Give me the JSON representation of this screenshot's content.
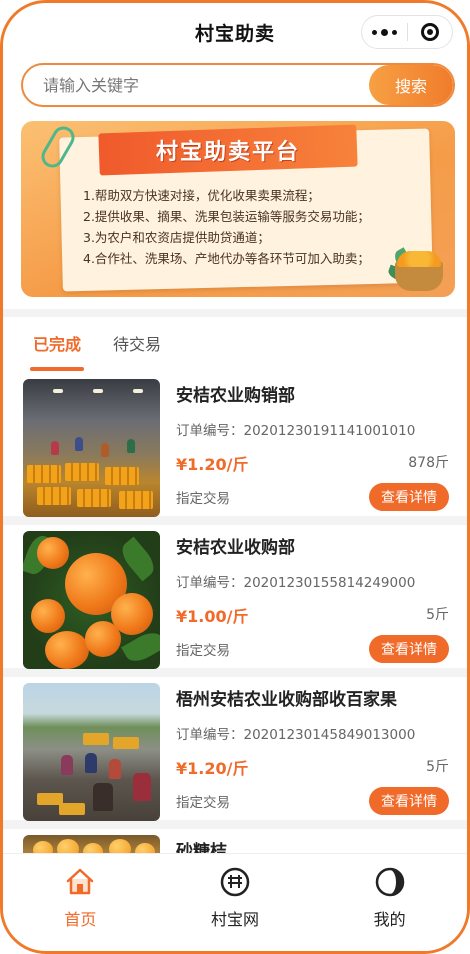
{
  "header": {
    "title": "村宝助卖",
    "more_icon": "more-dots-icon",
    "close_icon": "target-close-icon"
  },
  "search": {
    "placeholder": "请输入关键字",
    "button_label": "搜索"
  },
  "banner": {
    "heading": "村宝助卖平台",
    "lines": [
      "1.帮助双方快速对接，优化收果卖果流程；",
      "2.提供收果、摘果、洗果包装运输等服务交易功能；",
      "3.为农户和农资店提供助贷通道；",
      "4.合作社、洗果场、产地代办等各环节可加入助卖；"
    ]
  },
  "tabs": [
    {
      "label": "已完成",
      "active": true
    },
    {
      "label": "待交易",
      "active": false
    }
  ],
  "orders": [
    {
      "name": "安桔农业购销部",
      "order_label": "订单编号：",
      "order_no": "20201230191141001010",
      "price": "¥1.20/斤",
      "qty": "878斤",
      "trade": "指定交易",
      "button": "查看详情"
    },
    {
      "name": "安桔农业收购部",
      "order_label": "订单编号：",
      "order_no": "20201230155814249000",
      "price": "¥1.00/斤",
      "qty": "5斤",
      "trade": "指定交易",
      "button": "查看详情"
    },
    {
      "name": "梧州安桔农业收购部收百家果",
      "order_label": "订单编号：",
      "order_no": "20201230145849013000",
      "price": "¥1.20/斤",
      "qty": "5斤",
      "trade": "指定交易",
      "button": "查看详情"
    },
    {
      "name": "砂糖桔",
      "order_label": "",
      "order_no": "",
      "price": "",
      "qty": "",
      "trade": "",
      "button": ""
    }
  ],
  "bottom_nav": [
    {
      "label": "首页",
      "icon": "home-icon",
      "active": true
    },
    {
      "label": "村宝网",
      "icon": "cunbao-web-icon",
      "active": false
    },
    {
      "label": "我的",
      "icon": "profile-icon",
      "active": false
    }
  ],
  "colors": {
    "accent": "#f06a2a",
    "border": "#f07a2a",
    "search_btn": "#f7a043"
  }
}
